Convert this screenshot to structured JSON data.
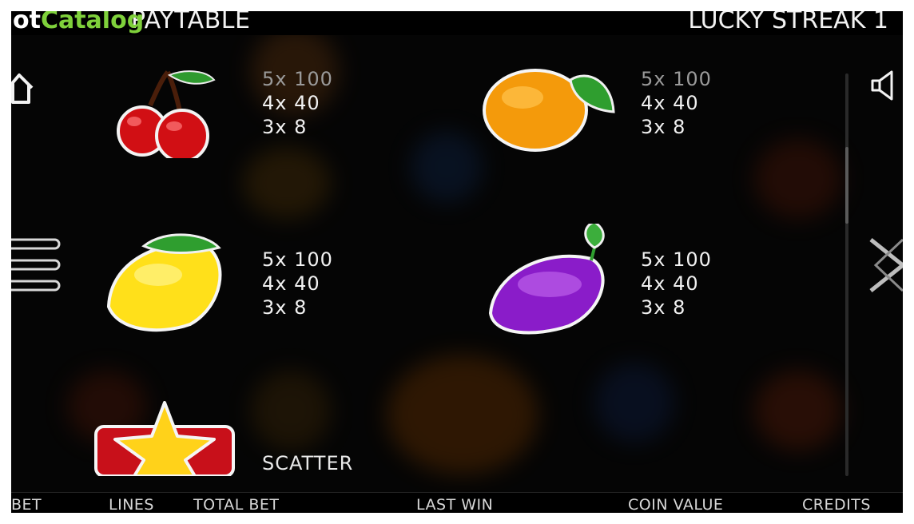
{
  "header": {
    "left_title": "PAYTABLE",
    "right_title": "LUCKY STREAK 1",
    "watermark_prefix": "ot",
    "watermark_brand": "Catalog"
  },
  "icons": {
    "home": "home-icon",
    "menu": "hamburger-menu-icon",
    "sound": "speaker-icon",
    "close": "close-x-icon"
  },
  "symbols": [
    {
      "name": "cherry",
      "payouts": [
        "5x 100",
        "4x 40",
        "3x 8"
      ]
    },
    {
      "name": "orange",
      "payouts": [
        "5x 100",
        "4x 40",
        "3x 8"
      ]
    },
    {
      "name": "lemon",
      "payouts": [
        "5x 100",
        "4x 40",
        "3x 8"
      ]
    },
    {
      "name": "plum",
      "payouts": [
        "5x 100",
        "4x 40",
        "3x 8"
      ]
    },
    {
      "name": "star",
      "label": "SCATTER"
    }
  ],
  "footer": {
    "bet": "BET",
    "lines": "LINES",
    "total_bet": "TOTAL BET",
    "last_win": "LAST WIN",
    "coin_value": "COIN VALUE",
    "credits": "CREDITS"
  },
  "colors": {
    "background": "#050505",
    "text": "#f1f1f1",
    "watermark_green": "#7fd13b"
  }
}
